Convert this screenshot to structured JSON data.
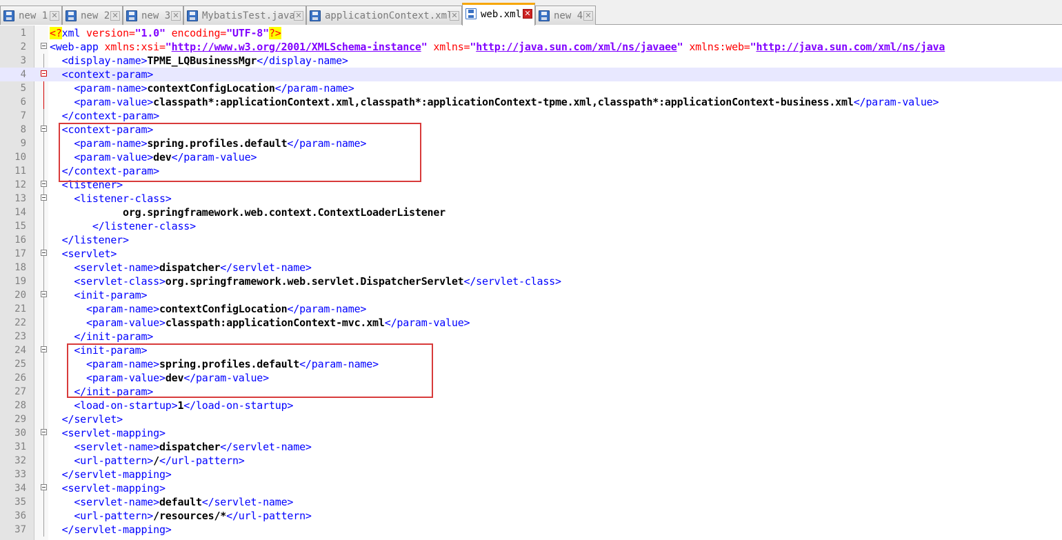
{
  "tabs": [
    {
      "label": "new 1",
      "active": false
    },
    {
      "label": "new 2",
      "active": false
    },
    {
      "label": "new 3",
      "active": false
    },
    {
      "label": "MybatisTest.java",
      "active": false
    },
    {
      "label": "applicationContext.xml",
      "active": false
    },
    {
      "label": "web.xml",
      "active": true
    },
    {
      "label": "new 4",
      "active": false
    }
  ],
  "tab_close_glyph": "✕",
  "tab_icon": "save-file-icon",
  "current_line": 4,
  "line_numbers": [
    "1",
    "2",
    "3",
    "4",
    "5",
    "6",
    "7",
    "8",
    "9",
    "10",
    "11",
    "12",
    "13",
    "14",
    "15",
    "16",
    "17",
    "18",
    "19",
    "20",
    "21",
    "22",
    "23",
    "24",
    "25",
    "26",
    "27",
    "28",
    "29",
    "30",
    "31",
    "32",
    "33",
    "34",
    "35",
    "36",
    "37"
  ],
  "lines": [
    [
      {
        "c": "pi",
        "s": "<?"
      },
      {
        "c": "t",
        "s": "xml "
      },
      {
        "c": "a",
        "s": "version="
      },
      {
        "c": "v",
        "s": "\"1.0\""
      },
      {
        "c": "a",
        "s": " encoding="
      },
      {
        "c": "v",
        "s": "\"UTF-8\""
      },
      {
        "c": "pi",
        "s": "?>"
      }
    ],
    [
      {
        "c": "t",
        "s": "<web-app "
      },
      {
        "c": "a",
        "s": "xmlns:xsi="
      },
      {
        "c": "v",
        "s": "\""
      },
      {
        "c": "u",
        "s": "http://www.w3.org/2001/XMLSchema-instance"
      },
      {
        "c": "v",
        "s": "\""
      },
      {
        "c": "a",
        "s": " xmlns="
      },
      {
        "c": "v",
        "s": "\""
      },
      {
        "c": "u",
        "s": "http://java.sun.com/xml/ns/javaee"
      },
      {
        "c": "v",
        "s": "\""
      },
      {
        "c": "a",
        "s": " xmlns:web="
      },
      {
        "c": "v",
        "s": "\""
      },
      {
        "c": "u",
        "s": "http://java.sun.com/xml/ns/java"
      }
    ],
    [
      {
        "c": "x",
        "s": "  "
      },
      {
        "c": "t",
        "s": "<display-name>"
      },
      {
        "c": "b",
        "s": "TPME_LQBusinessMgr"
      },
      {
        "c": "t",
        "s": "</display-name>"
      }
    ],
    [
      {
        "c": "x",
        "s": "  "
      },
      {
        "c": "t",
        "s": "<context-param>"
      }
    ],
    [
      {
        "c": "x",
        "s": "    "
      },
      {
        "c": "t",
        "s": "<param-name>"
      },
      {
        "c": "b",
        "s": "contextConfigLocation"
      },
      {
        "c": "t",
        "s": "</param-name>"
      }
    ],
    [
      {
        "c": "x",
        "s": "    "
      },
      {
        "c": "t",
        "s": "<param-value>"
      },
      {
        "c": "b",
        "s": "classpath*:applicationContext.xml,classpath*:applicationContext-tpme.xml,classpath*:applicationContext-business.xml"
      },
      {
        "c": "t",
        "s": "</param-value>"
      }
    ],
    [
      {
        "c": "x",
        "s": "  "
      },
      {
        "c": "t",
        "s": "</context-param>"
      }
    ],
    [
      {
        "c": "x",
        "s": "  "
      },
      {
        "c": "t",
        "s": "<context-param>"
      }
    ],
    [
      {
        "c": "x",
        "s": "    "
      },
      {
        "c": "t",
        "s": "<param-name>"
      },
      {
        "c": "b",
        "s": "spring.profiles.default"
      },
      {
        "c": "t",
        "s": "</param-name>"
      }
    ],
    [
      {
        "c": "x",
        "s": "    "
      },
      {
        "c": "t",
        "s": "<param-value>"
      },
      {
        "c": "b",
        "s": "dev"
      },
      {
        "c": "t",
        "s": "</param-value>"
      }
    ],
    [
      {
        "c": "x",
        "s": "  "
      },
      {
        "c": "t",
        "s": "</context-param>"
      }
    ],
    [
      {
        "c": "x",
        "s": "  "
      },
      {
        "c": "t",
        "s": "<listener>"
      }
    ],
    [
      {
        "c": "x",
        "s": "    "
      },
      {
        "c": "t",
        "s": "<listener-class>"
      }
    ],
    [
      {
        "c": "x",
        "s": "            "
      },
      {
        "c": "b",
        "s": "org.springframework.web.context.ContextLoaderListener"
      }
    ],
    [
      {
        "c": "x",
        "s": "       "
      },
      {
        "c": "t",
        "s": "</listener-class>"
      }
    ],
    [
      {
        "c": "x",
        "s": "  "
      },
      {
        "c": "t",
        "s": "</listener>"
      }
    ],
    [
      {
        "c": "x",
        "s": "  "
      },
      {
        "c": "t",
        "s": "<servlet>"
      }
    ],
    [
      {
        "c": "x",
        "s": "    "
      },
      {
        "c": "t",
        "s": "<servlet-name>"
      },
      {
        "c": "b",
        "s": "dispatcher"
      },
      {
        "c": "t",
        "s": "</servlet-name>"
      }
    ],
    [
      {
        "c": "x",
        "s": "    "
      },
      {
        "c": "t",
        "s": "<servlet-class>"
      },
      {
        "c": "b",
        "s": "org.springframework.web.servlet.DispatcherServlet"
      },
      {
        "c": "t",
        "s": "</servlet-class>"
      }
    ],
    [
      {
        "c": "x",
        "s": "    "
      },
      {
        "c": "t",
        "s": "<init-param>"
      }
    ],
    [
      {
        "c": "x",
        "s": "      "
      },
      {
        "c": "t",
        "s": "<param-name>"
      },
      {
        "c": "b",
        "s": "contextConfigLocation"
      },
      {
        "c": "t",
        "s": "</param-name>"
      }
    ],
    [
      {
        "c": "x",
        "s": "      "
      },
      {
        "c": "t",
        "s": "<param-value>"
      },
      {
        "c": "b",
        "s": "classpath:applicationContext-mvc.xml"
      },
      {
        "c": "t",
        "s": "</param-value>"
      }
    ],
    [
      {
        "c": "x",
        "s": "    "
      },
      {
        "c": "t",
        "s": "</init-param>"
      }
    ],
    [
      {
        "c": "x",
        "s": "    "
      },
      {
        "c": "t",
        "s": "<init-param>"
      }
    ],
    [
      {
        "c": "x",
        "s": "      "
      },
      {
        "c": "t",
        "s": "<param-name>"
      },
      {
        "c": "b",
        "s": "spring.profiles.default"
      },
      {
        "c": "t",
        "s": "</param-name>"
      }
    ],
    [
      {
        "c": "x",
        "s": "      "
      },
      {
        "c": "t",
        "s": "<param-value>"
      },
      {
        "c": "b",
        "s": "dev"
      },
      {
        "c": "t",
        "s": "</param-value>"
      }
    ],
    [
      {
        "c": "x",
        "s": "    "
      },
      {
        "c": "t",
        "s": "</init-param>"
      }
    ],
    [
      {
        "c": "x",
        "s": "    "
      },
      {
        "c": "t",
        "s": "<load-on-startup>"
      },
      {
        "c": "b",
        "s": "1"
      },
      {
        "c": "t",
        "s": "</load-on-startup>"
      }
    ],
    [
      {
        "c": "x",
        "s": "  "
      },
      {
        "c": "t",
        "s": "</servlet>"
      }
    ],
    [
      {
        "c": "x",
        "s": "  "
      },
      {
        "c": "t",
        "s": "<servlet-mapping>"
      }
    ],
    [
      {
        "c": "x",
        "s": "    "
      },
      {
        "c": "t",
        "s": "<servlet-name>"
      },
      {
        "c": "b",
        "s": "dispatcher"
      },
      {
        "c": "t",
        "s": "</servlet-name>"
      }
    ],
    [
      {
        "c": "x",
        "s": "    "
      },
      {
        "c": "t",
        "s": "<url-pattern>"
      },
      {
        "c": "b",
        "s": "/"
      },
      {
        "c": "t",
        "s": "</url-pattern>"
      }
    ],
    [
      {
        "c": "x",
        "s": "  "
      },
      {
        "c": "t",
        "s": "</servlet-mapping>"
      }
    ],
    [
      {
        "c": "x",
        "s": "  "
      },
      {
        "c": "t",
        "s": "<servlet-mapping>"
      }
    ],
    [
      {
        "c": "x",
        "s": "    "
      },
      {
        "c": "t",
        "s": "<servlet-name>"
      },
      {
        "c": "b",
        "s": "default"
      },
      {
        "c": "t",
        "s": "</servlet-name>"
      }
    ],
    [
      {
        "c": "x",
        "s": "    "
      },
      {
        "c": "t",
        "s": "<url-pattern>"
      },
      {
        "c": "b",
        "s": "/resources/*"
      },
      {
        "c": "t",
        "s": "</url-pattern>"
      }
    ],
    [
      {
        "c": "x",
        "s": "  "
      },
      {
        "c": "t",
        "s": "</servlet-mapping>"
      }
    ]
  ],
  "fold_markers": [
    2,
    4,
    8,
    12,
    13,
    17,
    20,
    24,
    30,
    34
  ],
  "highlighted_blocks": [
    {
      "from_line": 8,
      "to_line": 11
    },
    {
      "from_line": 24,
      "to_line": 27
    }
  ]
}
